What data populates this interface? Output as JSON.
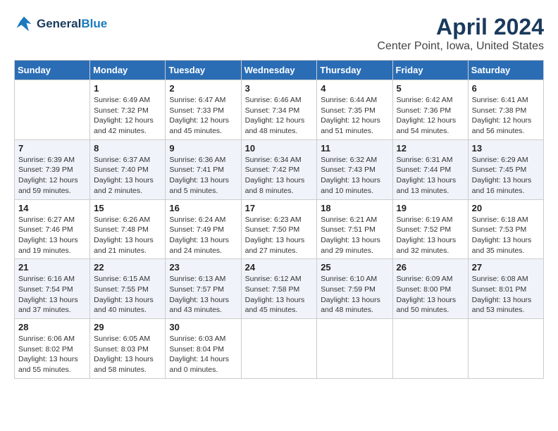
{
  "header": {
    "logo_line1": "General",
    "logo_line2": "Blue",
    "month_title": "April 2024",
    "location": "Center Point, Iowa, United States"
  },
  "weekdays": [
    "Sunday",
    "Monday",
    "Tuesday",
    "Wednesday",
    "Thursday",
    "Friday",
    "Saturday"
  ],
  "weeks": [
    [
      {
        "day": "",
        "sunrise": "",
        "sunset": "",
        "daylight": ""
      },
      {
        "day": "1",
        "sunrise": "Sunrise: 6:49 AM",
        "sunset": "Sunset: 7:32 PM",
        "daylight": "Daylight: 12 hours and 42 minutes."
      },
      {
        "day": "2",
        "sunrise": "Sunrise: 6:47 AM",
        "sunset": "Sunset: 7:33 PM",
        "daylight": "Daylight: 12 hours and 45 minutes."
      },
      {
        "day": "3",
        "sunrise": "Sunrise: 6:46 AM",
        "sunset": "Sunset: 7:34 PM",
        "daylight": "Daylight: 12 hours and 48 minutes."
      },
      {
        "day": "4",
        "sunrise": "Sunrise: 6:44 AM",
        "sunset": "Sunset: 7:35 PM",
        "daylight": "Daylight: 12 hours and 51 minutes."
      },
      {
        "day": "5",
        "sunrise": "Sunrise: 6:42 AM",
        "sunset": "Sunset: 7:36 PM",
        "daylight": "Daylight: 12 hours and 54 minutes."
      },
      {
        "day": "6",
        "sunrise": "Sunrise: 6:41 AM",
        "sunset": "Sunset: 7:38 PM",
        "daylight": "Daylight: 12 hours and 56 minutes."
      }
    ],
    [
      {
        "day": "7",
        "sunrise": "Sunrise: 6:39 AM",
        "sunset": "Sunset: 7:39 PM",
        "daylight": "Daylight: 12 hours and 59 minutes."
      },
      {
        "day": "8",
        "sunrise": "Sunrise: 6:37 AM",
        "sunset": "Sunset: 7:40 PM",
        "daylight": "Daylight: 13 hours and 2 minutes."
      },
      {
        "day": "9",
        "sunrise": "Sunrise: 6:36 AM",
        "sunset": "Sunset: 7:41 PM",
        "daylight": "Daylight: 13 hours and 5 minutes."
      },
      {
        "day": "10",
        "sunrise": "Sunrise: 6:34 AM",
        "sunset": "Sunset: 7:42 PM",
        "daylight": "Daylight: 13 hours and 8 minutes."
      },
      {
        "day": "11",
        "sunrise": "Sunrise: 6:32 AM",
        "sunset": "Sunset: 7:43 PM",
        "daylight": "Daylight: 13 hours and 10 minutes."
      },
      {
        "day": "12",
        "sunrise": "Sunrise: 6:31 AM",
        "sunset": "Sunset: 7:44 PM",
        "daylight": "Daylight: 13 hours and 13 minutes."
      },
      {
        "day": "13",
        "sunrise": "Sunrise: 6:29 AM",
        "sunset": "Sunset: 7:45 PM",
        "daylight": "Daylight: 13 hours and 16 minutes."
      }
    ],
    [
      {
        "day": "14",
        "sunrise": "Sunrise: 6:27 AM",
        "sunset": "Sunset: 7:46 PM",
        "daylight": "Daylight: 13 hours and 19 minutes."
      },
      {
        "day": "15",
        "sunrise": "Sunrise: 6:26 AM",
        "sunset": "Sunset: 7:48 PM",
        "daylight": "Daylight: 13 hours and 21 minutes."
      },
      {
        "day": "16",
        "sunrise": "Sunrise: 6:24 AM",
        "sunset": "Sunset: 7:49 PM",
        "daylight": "Daylight: 13 hours and 24 minutes."
      },
      {
        "day": "17",
        "sunrise": "Sunrise: 6:23 AM",
        "sunset": "Sunset: 7:50 PM",
        "daylight": "Daylight: 13 hours and 27 minutes."
      },
      {
        "day": "18",
        "sunrise": "Sunrise: 6:21 AM",
        "sunset": "Sunset: 7:51 PM",
        "daylight": "Daylight: 13 hours and 29 minutes."
      },
      {
        "day": "19",
        "sunrise": "Sunrise: 6:19 AM",
        "sunset": "Sunset: 7:52 PM",
        "daylight": "Daylight: 13 hours and 32 minutes."
      },
      {
        "day": "20",
        "sunrise": "Sunrise: 6:18 AM",
        "sunset": "Sunset: 7:53 PM",
        "daylight": "Daylight: 13 hours and 35 minutes."
      }
    ],
    [
      {
        "day": "21",
        "sunrise": "Sunrise: 6:16 AM",
        "sunset": "Sunset: 7:54 PM",
        "daylight": "Daylight: 13 hours and 37 minutes."
      },
      {
        "day": "22",
        "sunrise": "Sunrise: 6:15 AM",
        "sunset": "Sunset: 7:55 PM",
        "daylight": "Daylight: 13 hours and 40 minutes."
      },
      {
        "day": "23",
        "sunrise": "Sunrise: 6:13 AM",
        "sunset": "Sunset: 7:57 PM",
        "daylight": "Daylight: 13 hours and 43 minutes."
      },
      {
        "day": "24",
        "sunrise": "Sunrise: 6:12 AM",
        "sunset": "Sunset: 7:58 PM",
        "daylight": "Daylight: 13 hours and 45 minutes."
      },
      {
        "day": "25",
        "sunrise": "Sunrise: 6:10 AM",
        "sunset": "Sunset: 7:59 PM",
        "daylight": "Daylight: 13 hours and 48 minutes."
      },
      {
        "day": "26",
        "sunrise": "Sunrise: 6:09 AM",
        "sunset": "Sunset: 8:00 PM",
        "daylight": "Daylight: 13 hours and 50 minutes."
      },
      {
        "day": "27",
        "sunrise": "Sunrise: 6:08 AM",
        "sunset": "Sunset: 8:01 PM",
        "daylight": "Daylight: 13 hours and 53 minutes."
      }
    ],
    [
      {
        "day": "28",
        "sunrise": "Sunrise: 6:06 AM",
        "sunset": "Sunset: 8:02 PM",
        "daylight": "Daylight: 13 hours and 55 minutes."
      },
      {
        "day": "29",
        "sunrise": "Sunrise: 6:05 AM",
        "sunset": "Sunset: 8:03 PM",
        "daylight": "Daylight: 13 hours and 58 minutes."
      },
      {
        "day": "30",
        "sunrise": "Sunrise: 6:03 AM",
        "sunset": "Sunset: 8:04 PM",
        "daylight": "Daylight: 14 hours and 0 minutes."
      },
      {
        "day": "",
        "sunrise": "",
        "sunset": "",
        "daylight": ""
      },
      {
        "day": "",
        "sunrise": "",
        "sunset": "",
        "daylight": ""
      },
      {
        "day": "",
        "sunrise": "",
        "sunset": "",
        "daylight": ""
      },
      {
        "day": "",
        "sunrise": "",
        "sunset": "",
        "daylight": ""
      }
    ]
  ]
}
